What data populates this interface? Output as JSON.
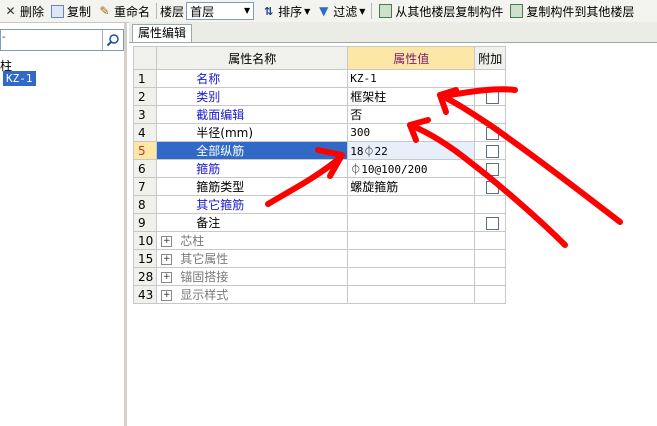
{
  "toolbar": {
    "delete_label": "删除",
    "copy_label": "复制",
    "rename_label": "重命名",
    "floor_label": "楼层",
    "floor_select": "首层",
    "sort_label": "排序",
    "filter_label": "过滤",
    "copy_from_other_label": "从其他楼层复制构件",
    "copy_to_other_label": "复制构件到其他楼层"
  },
  "left_panel": {
    "search_value": "-",
    "tree_parent": "柱",
    "tree_selected": "KZ-1"
  },
  "tab": {
    "label": "属性编辑"
  },
  "grid": {
    "headers": {
      "name": "属性名称",
      "value": "属性值",
      "extra": "附加"
    },
    "rows": [
      {
        "num": "1",
        "name": "名称",
        "value": "KZ-1",
        "name_color": "blue",
        "checkbox": false
      },
      {
        "num": "2",
        "name": "类别",
        "value": "框架柱",
        "name_color": "blue",
        "checkbox": true
      },
      {
        "num": "3",
        "name": "截面编辑",
        "value": "否",
        "name_color": "blue",
        "checkbox": false
      },
      {
        "num": "4",
        "name": "半径(mm)",
        "value": "300",
        "name_color": "black",
        "checkbox": true
      },
      {
        "num": "5",
        "name": "全部纵筋",
        "value": "18⏀22",
        "name_color": "blue",
        "checkbox": true,
        "selected": true
      },
      {
        "num": "6",
        "name": "箍筋",
        "value": "⏀10@100/200",
        "name_color": "blue",
        "checkbox": true
      },
      {
        "num": "7",
        "name": "箍筋类型",
        "value": "螺旋箍筋",
        "name_color": "black",
        "checkbox": true
      },
      {
        "num": "8",
        "name": "其它箍筋",
        "value": "",
        "name_color": "blue",
        "checkbox": false
      },
      {
        "num": "9",
        "name": "备注",
        "value": "",
        "name_color": "black",
        "checkbox": true
      }
    ],
    "groups": [
      {
        "num": "10",
        "name": "芯柱"
      },
      {
        "num": "15",
        "name": "其它属性"
      },
      {
        "num": "28",
        "name": "锚固搭接"
      },
      {
        "num": "43",
        "name": "显示样式"
      }
    ]
  },
  "colors": {
    "selection": "#3169c6",
    "header_highlight": "#fde7a6",
    "annotation_red": "#ff0000",
    "name_blue": "#1a1acc"
  }
}
